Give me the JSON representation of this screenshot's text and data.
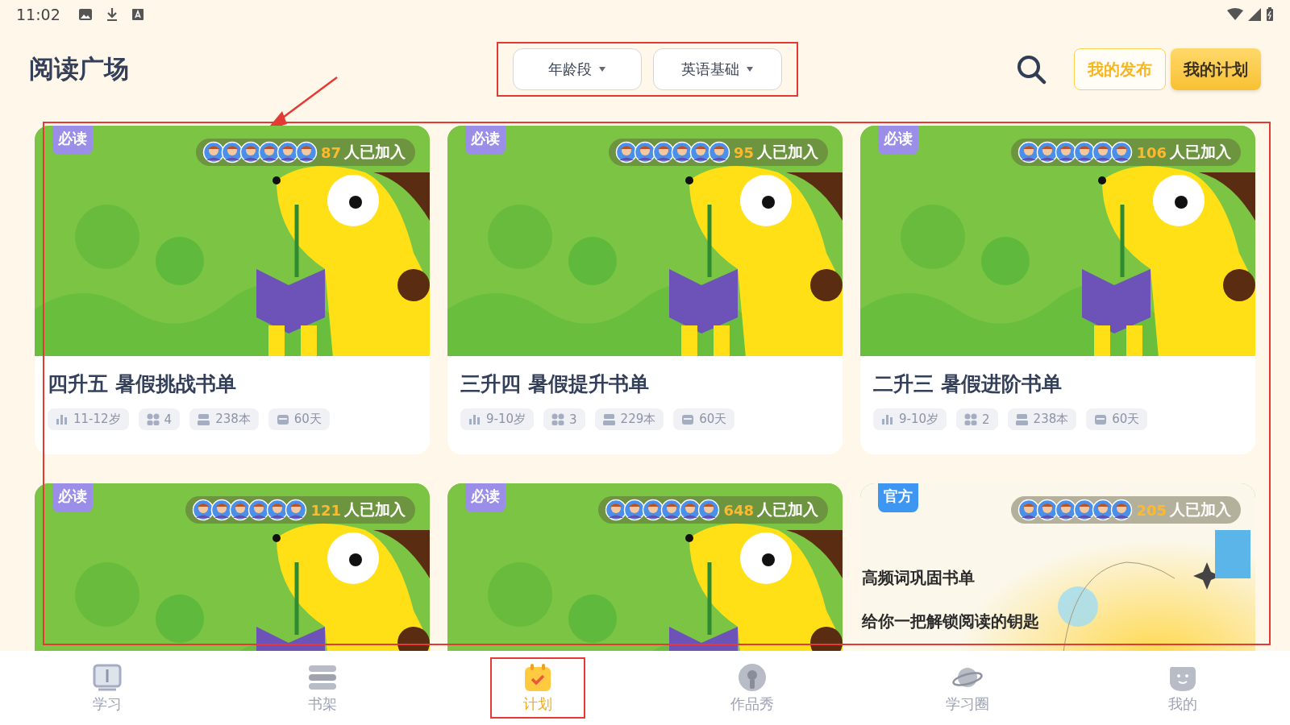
{
  "status_bar": {
    "time": "11:02"
  },
  "header": {
    "title": "阅读广场",
    "filters": [
      {
        "label": "年龄段"
      },
      {
        "label": "英语基础"
      }
    ],
    "filters_highlighted": true,
    "buttons": [
      {
        "label": "我的发布",
        "kind": "outline"
      },
      {
        "label": "我的计划",
        "kind": "filled"
      }
    ]
  },
  "annotation_arrow": true,
  "grid_highlighted": true,
  "cards": [
    {
      "kind": "giraffe",
      "badge": "必读",
      "joined_count": "87",
      "joined_label": "人已加入",
      "title": "四升五  暑假挑战书单",
      "stats": [
        {
          "kind": "age",
          "text": "11-12岁"
        },
        {
          "kind": "groups",
          "text": "4"
        },
        {
          "kind": "books",
          "text": "238本"
        },
        {
          "kind": "days",
          "text": "60天"
        }
      ]
    },
    {
      "kind": "giraffe",
      "badge": "必读",
      "joined_count": "95",
      "joined_label": "人已加入",
      "title": "三升四  暑假提升书单",
      "stats": [
        {
          "kind": "age",
          "text": "9-10岁"
        },
        {
          "kind": "groups",
          "text": "3"
        },
        {
          "kind": "books",
          "text": "229本"
        },
        {
          "kind": "days",
          "text": "60天"
        }
      ]
    },
    {
      "kind": "giraffe",
      "badge": "必读",
      "joined_count": "106",
      "joined_label": "人已加入",
      "title": "二升三  暑假进阶书单",
      "stats": [
        {
          "kind": "age",
          "text": "9-10岁"
        },
        {
          "kind": "groups",
          "text": "2"
        },
        {
          "kind": "books",
          "text": "238本"
        },
        {
          "kind": "days",
          "text": "60天"
        }
      ]
    },
    {
      "kind": "giraffe",
      "badge": "必读",
      "joined_count": "121",
      "joined_label": "人已加入"
    },
    {
      "kind": "giraffe",
      "badge": "必读",
      "joined_count": "648",
      "joined_label": "人已加入"
    },
    {
      "kind": "official",
      "badge": "官方",
      "joined_count": "205",
      "joined_label": "人已加入",
      "cover_title": "高频词巩固书单",
      "cover_subtitle": "给你一把解锁阅读的钥匙"
    }
  ],
  "nav": [
    {
      "label": "学习",
      "selected": false,
      "highlighted": false
    },
    {
      "label": "书架",
      "selected": false,
      "highlighted": false
    },
    {
      "label": "计划",
      "selected": true,
      "highlighted": true
    },
    {
      "label": "作品秀",
      "selected": false,
      "highlighted": false
    },
    {
      "label": "学习圈",
      "selected": false,
      "highlighted": false
    },
    {
      "label": "我的",
      "selected": false,
      "highlighted": false
    }
  ]
}
